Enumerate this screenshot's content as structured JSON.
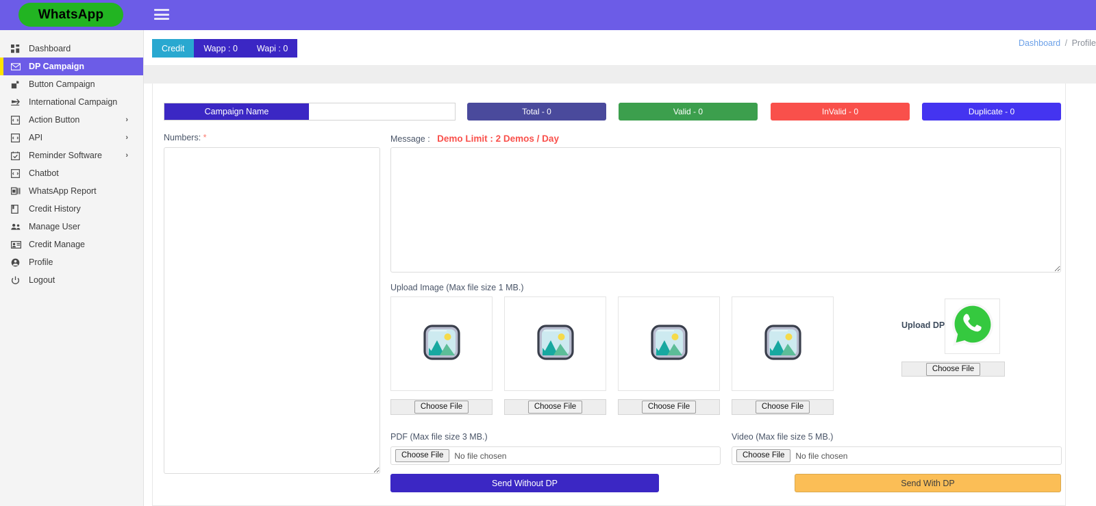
{
  "header": {
    "brand": "WhatsApp",
    "menu_toggle_icon": "hamburger-icon",
    "bg_color": "#6c5ce7",
    "brand_bg_color": "#22b422"
  },
  "breadcrumb": {
    "items": [
      "Dashboard",
      "Profile"
    ],
    "separator": "/"
  },
  "sidebar": {
    "items": [
      {
        "label": "Dashboard",
        "icon": "grid-dashboard-icon",
        "active": false,
        "has_submenu": false
      },
      {
        "label": "DP Campaign",
        "icon": "envelope-icon",
        "active": true,
        "has_submenu": false
      },
      {
        "label": "Button Campaign",
        "icon": "mailbox-icon",
        "active": false,
        "has_submenu": false
      },
      {
        "label": "International Campaign",
        "icon": "airplane-icon",
        "active": false,
        "has_submenu": false
      },
      {
        "label": "Action Button",
        "icon": "window-code-icon",
        "active": false,
        "has_submenu": true
      },
      {
        "label": "API",
        "icon": "window-code-icon",
        "active": false,
        "has_submenu": true
      },
      {
        "label": "Reminder Software",
        "icon": "calendar-check-icon",
        "active": false,
        "has_submenu": true
      },
      {
        "label": "Chatbot",
        "icon": "window-code-icon",
        "active": false,
        "has_submenu": false
      },
      {
        "label": "WhatsApp Report",
        "icon": "report-chart-icon",
        "active": false,
        "has_submenu": false
      },
      {
        "label": "Credit History",
        "icon": "book-icon",
        "active": false,
        "has_submenu": false
      },
      {
        "label": "Manage User",
        "icon": "users-icon",
        "active": false,
        "has_submenu": false
      },
      {
        "label": "Credit Manage",
        "icon": "id-card-icon",
        "active": false,
        "has_submenu": false
      },
      {
        "label": "Profile",
        "icon": "user-circle-icon",
        "active": false,
        "has_submenu": false
      },
      {
        "label": "Logout",
        "icon": "power-icon",
        "active": false,
        "has_submenu": false
      }
    ],
    "active_indicator_color": "#ffe400",
    "active_bg_color": "#6c5ce7"
  },
  "tabs": {
    "items": [
      {
        "label": "Credit",
        "color": "#29a8d0",
        "selected": true
      },
      {
        "label": "Wapp : 0",
        "color": "#3b27c4",
        "selected": false
      },
      {
        "label": "Wapi : 0",
        "color": "#3b27c4",
        "selected": false
      }
    ]
  },
  "form": {
    "campaign_name": {
      "addon_label": "Campaign Name",
      "value": "",
      "placeholder": ""
    },
    "badges": [
      {
        "label": "Total - 0",
        "color": "#4a4a9c"
      },
      {
        "label": "Valid - 0",
        "color": "#3c9f4d"
      },
      {
        "label": "InValid - 0",
        "color": "#f9504b"
      },
      {
        "label": "Duplicate - 0",
        "color": "#4434f0"
      }
    ],
    "numbers": {
      "label": "Numbers:",
      "required_marker": "*",
      "value": "",
      "placeholder": ""
    },
    "message": {
      "label": "Message :",
      "notice": "Demo Limit : 2 Demos / Day",
      "notice_color": "#f9504b",
      "value": "",
      "placeholder": ""
    },
    "upload_image": {
      "label": "Upload Image (Max file size 1 MB.)",
      "slots": [
        {
          "button_label": "Choose File",
          "preview_icon": "image-placeholder-icon"
        },
        {
          "button_label": "Choose File",
          "preview_icon": "image-placeholder-icon"
        },
        {
          "button_label": "Choose File",
          "preview_icon": "image-placeholder-icon"
        },
        {
          "button_label": "Choose File",
          "preview_icon": "image-placeholder-icon"
        }
      ]
    },
    "upload_dp": {
      "label": "Upload DP",
      "preview_icon": "whatsapp-logo-icon",
      "button_label": "Choose File"
    },
    "pdf": {
      "label": "PDF (Max file size 3 MB.)",
      "button_label": "Choose File",
      "status": "No file chosen"
    },
    "video": {
      "label": "Video (Max file size 5 MB.)",
      "button_label": "Choose File",
      "status": "No file chosen"
    },
    "actions": {
      "send_without_dp": "Send Without DP",
      "send_without_dp_color": "#3b27c4",
      "send_with_dp": "Send With DP",
      "send_with_dp_color": "#fbbe56"
    }
  }
}
